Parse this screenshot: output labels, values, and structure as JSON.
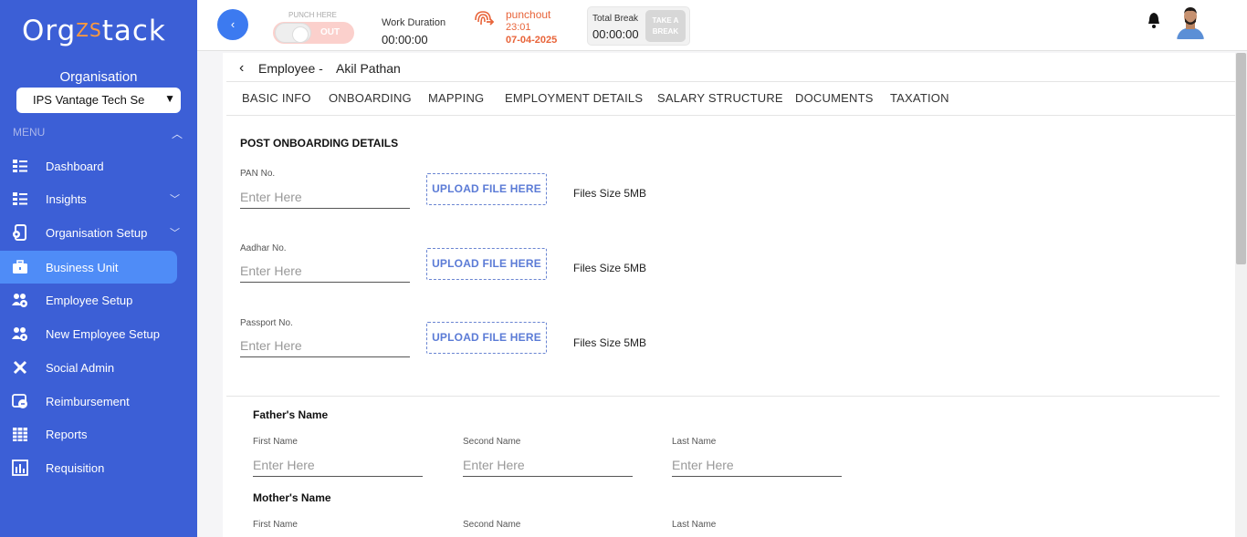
{
  "brand": {
    "logo_part1": "Org",
    "logo_mid": "ZS",
    "logo_part2": "tack"
  },
  "sidebar": {
    "org_label": "Organisation",
    "org_select": "IPS Vantage Tech Se",
    "menu_label": "MENU",
    "items": [
      {
        "label": "Dashboard",
        "icon": "dashboard-icon"
      },
      {
        "label": "Insights",
        "icon": "insights-icon"
      },
      {
        "label": "Organisation Setup",
        "icon": "organisation-setup-icon"
      },
      {
        "label": "Business Unit",
        "icon": "briefcase-icon"
      },
      {
        "label": "Employee Setup",
        "icon": "employee-setup-icon"
      },
      {
        "label": "New Employee Setup",
        "icon": "new-employee-setup-icon"
      },
      {
        "label": "Social Admin",
        "icon": "social-admin-icon"
      },
      {
        "label": "Reimbursement",
        "icon": "reimbursement-icon"
      },
      {
        "label": "Reports",
        "icon": "reports-icon"
      },
      {
        "label": "Requisition",
        "icon": "requisition-icon"
      }
    ]
  },
  "topbar": {
    "collapse_glyph": "‹",
    "punch_label": "PUNCH HERE",
    "punch_state": "OUT",
    "work_duration_label": "Work Duration",
    "work_duration_value": "00:00:00",
    "punchout_label": "punchout",
    "punchout_time": "23:01",
    "punchout_date": "07-04-2025",
    "total_break_label": "Total Break",
    "total_break_value": "00:00:00",
    "take_break_line1": "TAKE A",
    "take_break_line2": "BREAK"
  },
  "employee": {
    "title": "Employee -",
    "name": "Akil Pathan"
  },
  "tabs": [
    "BASIC INFO",
    "ONBOARDING",
    "MAPPING",
    "EMPLOYMENT DETAILS",
    "SALARY STRUCTURE",
    "DOCUMENTS",
    "TAXATION"
  ],
  "onboarding": {
    "section_title": "POST ONBOARDING DETAILS",
    "documents": [
      {
        "label": "PAN No.",
        "placeholder": "Enter Here",
        "upload_label": "UPLOAD FILE HERE",
        "size_note": "Files Size 5MB"
      },
      {
        "label": "Aadhar No.",
        "placeholder": "Enter Here",
        "upload_label": "UPLOAD FILE HERE",
        "size_note": "Files Size 5MB"
      },
      {
        "label": "Passport No.",
        "placeholder": "Enter Here",
        "upload_label": "UPLOAD FILE HERE",
        "size_note": "Files Size 5MB"
      }
    ]
  },
  "father": {
    "heading": "Father's Name",
    "fields": [
      {
        "label": "First Name",
        "placeholder": "Enter Here"
      },
      {
        "label": "Second Name",
        "placeholder": "Enter Here"
      },
      {
        "label": "Last Name",
        "placeholder": "Enter Here"
      }
    ]
  },
  "mother": {
    "heading": "Mother's Name",
    "fields": [
      {
        "label": "First Name"
      },
      {
        "label": "Second Name"
      },
      {
        "label": "Last Name"
      }
    ]
  }
}
